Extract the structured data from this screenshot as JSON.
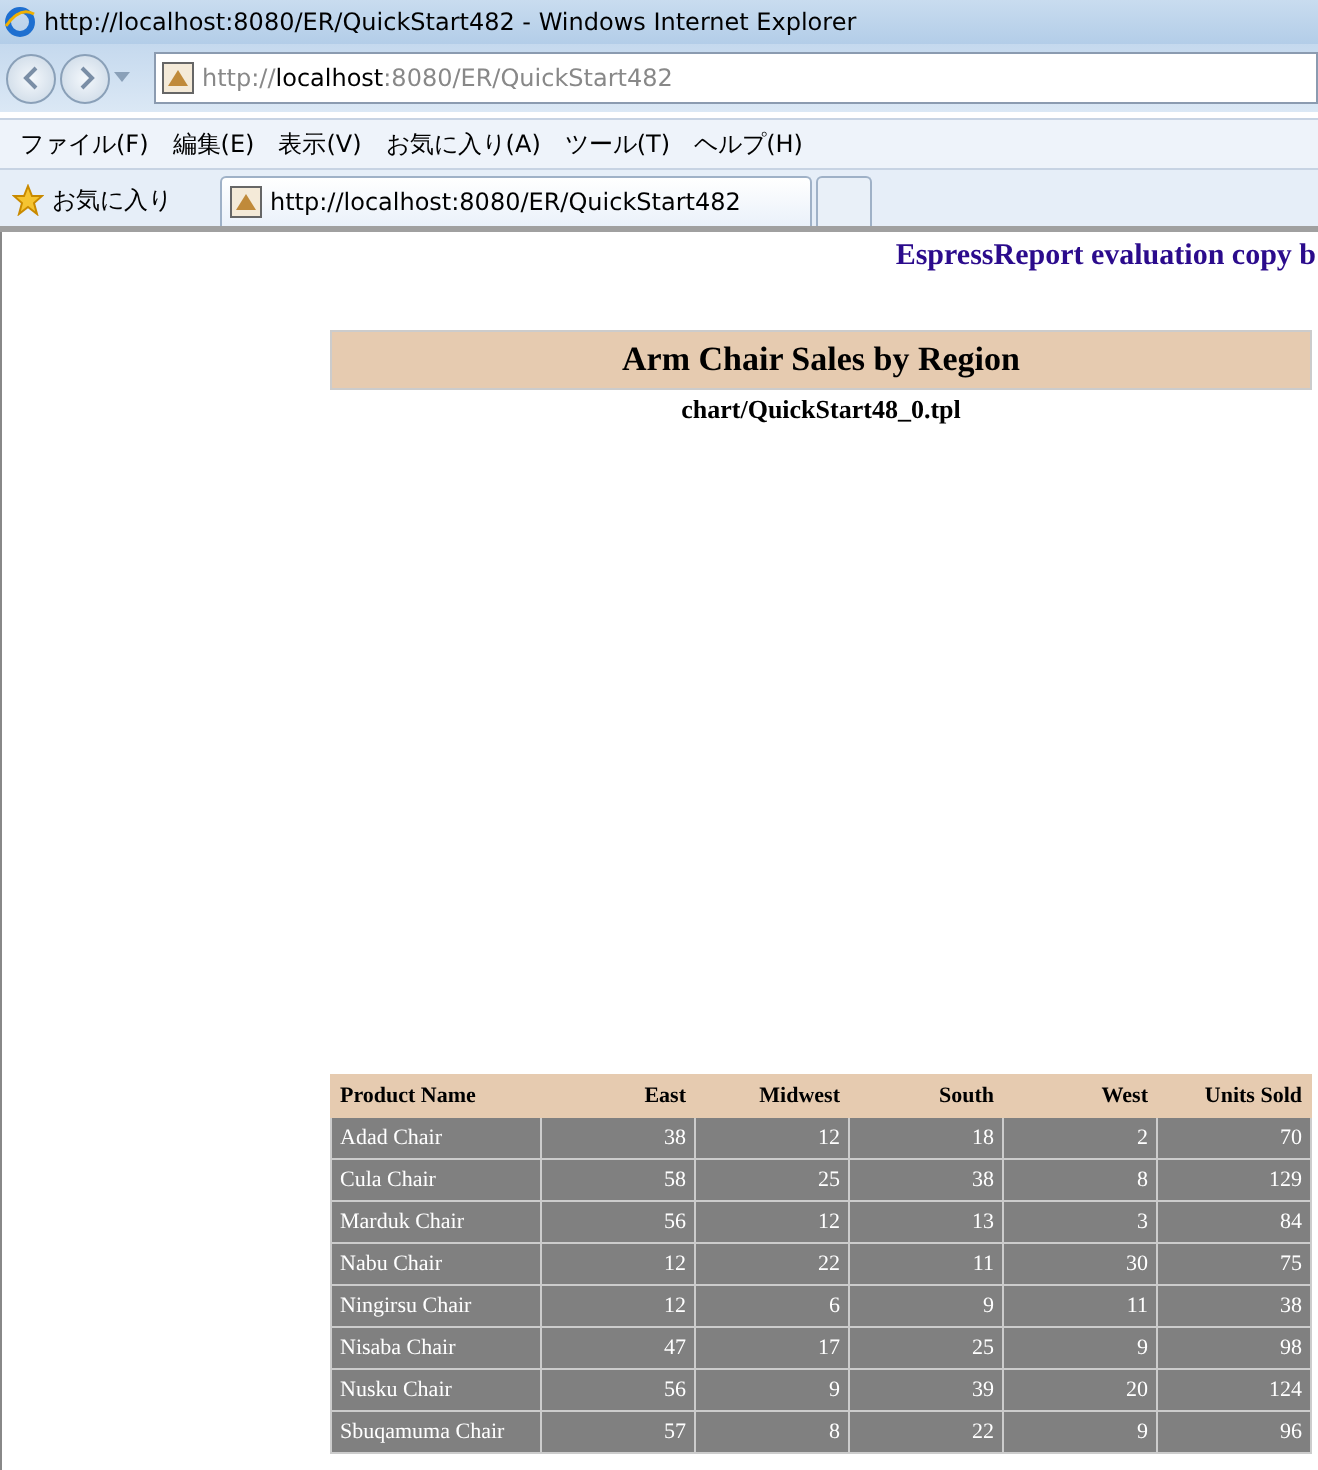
{
  "window": {
    "title": "http://localhost:8080/ER/QuickStart482 - Windows Internet Explorer"
  },
  "address_bar": {
    "value_prefix": "http://",
    "value_host": "localhost",
    "value_rest": ":8080/ER/QuickStart482"
  },
  "menu": [
    "ファイル(F)",
    "編集(E)",
    "表示(V)",
    "お気に入り(A)",
    "ツール(T)",
    "ヘルプ(H)"
  ],
  "favorites": {
    "label": "お気に入り"
  },
  "tabs": [
    {
      "label": "http://localhost:8080/ER/QuickStart482",
      "selected": true
    },
    {
      "selected": false
    }
  ],
  "page": {
    "watermark": "EspressReport evaluation copy b",
    "report_title": "Arm Chair Sales by Region",
    "chart_caption": "chart/QuickStart48_0.tpl"
  },
  "table": {
    "columns": [
      "Product Name",
      "East",
      "Midwest",
      "South",
      "West",
      "Units Sold"
    ],
    "rows": [
      [
        "Adad Chair",
        "38",
        "12",
        "18",
        "2",
        "70"
      ],
      [
        "Cula Chair",
        "58",
        "25",
        "38",
        "8",
        "129"
      ],
      [
        "Marduk Chair",
        "56",
        "12",
        "13",
        "3",
        "84"
      ],
      [
        "Nabu Chair",
        "12",
        "22",
        "11",
        "30",
        "75"
      ],
      [
        "Ningirsu Chair",
        "12",
        "6",
        "9",
        "11",
        "38"
      ],
      [
        "Nisaba Chair",
        "47",
        "17",
        "25",
        "9",
        "98"
      ],
      [
        "Nusku Chair",
        "56",
        "9",
        "39",
        "20",
        "124"
      ],
      [
        "Sbuqamuma Chair",
        "57",
        "8",
        "22",
        "9",
        "96"
      ]
    ]
  }
}
